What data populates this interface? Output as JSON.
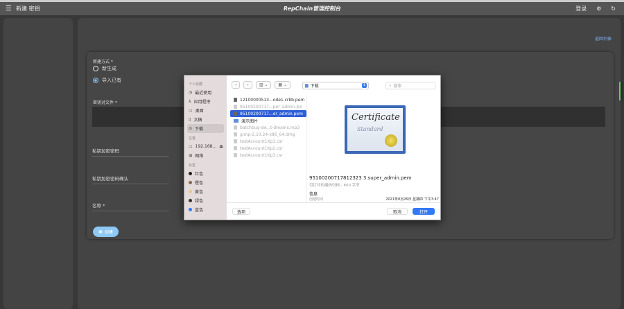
{
  "header": {
    "menu_icon": "hamburger-icon",
    "title": "新建 密钥",
    "app_title": "RepChain管理控制台",
    "login": "登录",
    "settings_icon": "gear-icon",
    "refresh_icon": "refresh-icon"
  },
  "main": {
    "back_link": "返回列表",
    "form": {
      "method_label": "新建方式 *",
      "option_new": "新生成",
      "option_import": "导入已有",
      "selected": "导入已有",
      "keyfile_label": "密钥对文件 *",
      "password_label": "私钥加密密码",
      "password_confirm_label": "私钥加密密码确认",
      "name_label": "名称 *",
      "create_button": "创建"
    }
  },
  "dialog": {
    "sidebar": {
      "favorites_title": "个人收藏",
      "favorites": [
        "最近使用",
        "应用程序",
        "桌面",
        "文稿",
        "下载"
      ],
      "selected": "下载",
      "locations_title": "位置",
      "locations": [
        "192.168...",
        "网络"
      ],
      "tags_title": "标签",
      "tags": [
        {
          "label": "红色",
          "color": "#222222"
        },
        {
          "label": "橙色",
          "color": "#8a6a50"
        },
        {
          "label": "黄色",
          "color": "#e8c890"
        },
        {
          "label": "绿色",
          "color": "#333333"
        },
        {
          "label": "蓝色",
          "color": "#3478f6"
        }
      ]
    },
    "location": "下载",
    "search_placeholder": "搜索",
    "files": [
      {
        "name": "12100000513...ode1.crbb.pem",
        "state": "normal"
      },
      {
        "name": "95100200717...per_admin.jks",
        "state": "dim"
      },
      {
        "name": "95100200717...er_admin.pem",
        "state": "selected"
      },
      {
        "name": "演示图片",
        "state": "folder"
      },
      {
        "name": "batchbug-sw...t-dreams.mp3",
        "state": "dim"
      },
      {
        "name": "gimp-2.10.24-x86_64.dmg",
        "state": "dim"
      },
      {
        "name": "testAccount1Kp1.csr",
        "state": "dim"
      },
      {
        "name": "testAccount1Kp2.csr",
        "state": "dim"
      },
      {
        "name": "testAccount1Kp3.csr",
        "state": "dim"
      }
    ],
    "preview": {
      "cert_title": "Certificate",
      "cert_sub": "Standard",
      "file_name": "95100200717812323 3.super_admin.pem",
      "kind": "可打印的编码归档 - 800 字节",
      "info": "信息",
      "created_label": "创建时间",
      "created_value": "2021年8月26日 星期四 下午3:47"
    },
    "options_button": "选项",
    "cancel_button": "取消",
    "open_button": "打开"
  }
}
